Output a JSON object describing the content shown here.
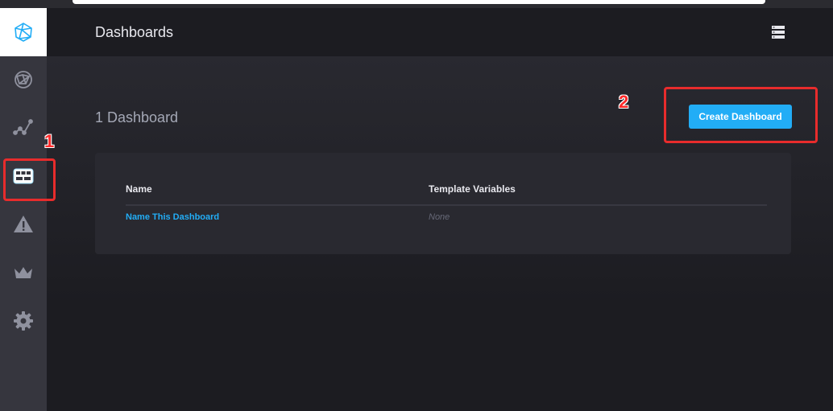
{
  "header": {
    "title": "Dashboards"
  },
  "sidebar": {
    "items": [
      {
        "icon": "logo-icon"
      },
      {
        "icon": "host-list-icon"
      },
      {
        "icon": "graph-icon"
      },
      {
        "icon": "dashboards-icon",
        "active": true
      },
      {
        "icon": "alert-icon"
      },
      {
        "icon": "admin-crown-icon"
      },
      {
        "icon": "gear-icon"
      }
    ]
  },
  "main": {
    "count_label": "1 Dashboard",
    "create_button": "Create Dashboard",
    "table": {
      "columns": [
        "Name",
        "Template Variables"
      ],
      "rows": [
        {
          "name": "Name This Dashboard",
          "template_variables": "None"
        }
      ]
    }
  },
  "annotations": {
    "one": "1",
    "two": "2"
  },
  "colors": {
    "accent": "#22adf6",
    "annotation": "#e82c2c",
    "sidebar": "#36363e",
    "background": "#1c1c21"
  }
}
